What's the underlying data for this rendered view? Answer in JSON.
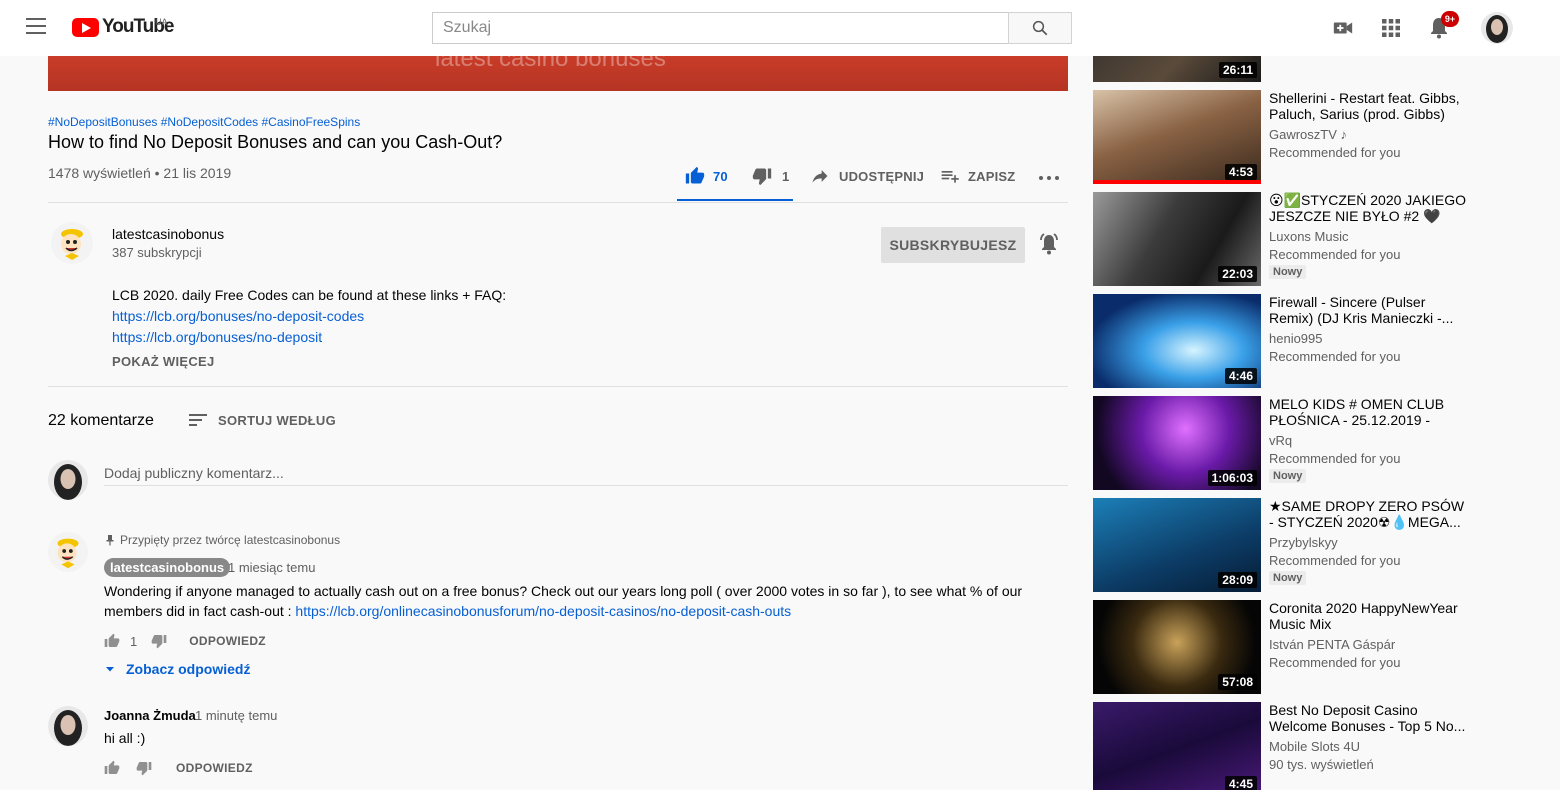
{
  "header": {
    "logo_text": "YouTube",
    "country": "UA",
    "search_placeholder": "Szukaj",
    "notifications_badge": "9+"
  },
  "video": {
    "watermark_text": "latest casino bonuses",
    "hashtags": [
      "#NoDepositBonuses",
      "#NoDepositCodes",
      "#CasinoFreeSpins"
    ],
    "title": "How to find No Deposit Bonuses and can you Cash-Out?",
    "views_date": "1478 wyświetleń • 21 lis 2019",
    "likes": "70",
    "dislikes": "1",
    "share_label": "UDOSTĘPNIJ",
    "save_label": "ZAPISZ"
  },
  "channel": {
    "name": "latestcasinobonus",
    "subscribers": "387 subskrypcji",
    "subscribed_label": "SUBSKRYBUJESZ"
  },
  "description": {
    "line1": "LCB 2020. daily Free Codes can be found at these links + FAQ:",
    "link1": "https://lcb.org/bonuses/no-deposit-codes",
    "link2": "https://lcb.org/bonuses/no-deposit",
    "show_more": "POKAŻ WIĘCEJ"
  },
  "comments": {
    "count": "22 komentarze",
    "sort_label": "SORTUJ WEDŁUG",
    "input_placeholder": "Dodaj publiczny komentarz...",
    "pinned": {
      "pinned_label": "Przypięty przez twórcę latestcasinobonus",
      "author": "latestcasinobonus",
      "time": "1 miesiąc temu",
      "text_line1": "Wondering if anyone managed to actually cash out on a free bonus? Check out our years long poll ( over 2000 votes in so far ),  to see what % of our",
      "text_line2": "members did in fact cash-out : ",
      "link": "https://lcb.org/onlinecasinobonusforum/no-deposit-casinos/no-deposit-cash-outs",
      "likes": "1",
      "reply_label": "ODPOWIEDZ",
      "view_replies": "Zobacz odpowiedź"
    },
    "second": {
      "author": "Joanna Żmuda",
      "time": "1 minutę temu",
      "text": "hi all :)",
      "reply_label": "ODPOWIEDZ"
    }
  },
  "recommendations": [
    {
      "title": "",
      "channel": "",
      "meta": "",
      "duration": "26:11",
      "badge": ""
    },
    {
      "title": "Shellerini - Restart feat. Gibbs, Paluch, Sarius (prod. Gibbs)",
      "channel": "GawroszTV ♪",
      "meta": "Recommended for you",
      "duration": "4:53",
      "badge": "",
      "progress": 1.0
    },
    {
      "title": "😮✅STYCZEŃ 2020 JAKIEGO JESZCZE NIE BYŁO #2 🖤✅...",
      "channel": "Luxons Music",
      "meta": "Recommended for you",
      "duration": "22:03",
      "badge": "Nowy"
    },
    {
      "title": "Firewall - Sincere (Pulser Remix) (DJ Kris Manieczki -...",
      "channel": "henio995",
      "meta": "Recommended for you",
      "duration": "4:46",
      "badge": ""
    },
    {
      "title": "MELO KIDS # OMEN CLUB PŁOŚNICA - 25.12.2019 - BOŻ...",
      "channel": "vRq",
      "meta": "Recommended for you",
      "duration": "1:06:03",
      "badge": "Nowy"
    },
    {
      "title": "★SAME DROPY ZERO PSÓW - STYCZEŃ 2020☢💧MEGA...",
      "channel": "Przybylskyy",
      "meta": "Recommended for you",
      "duration": "28:09",
      "badge": "Nowy"
    },
    {
      "title": "Coronita 2020 HappyNewYear Music Mix",
      "channel": "István PENTA Gáspár",
      "meta": "Recommended for you",
      "duration": "57:08",
      "badge": ""
    },
    {
      "title": "Best No Deposit Casino Welcome Bonuses - Top 5 No...",
      "channel": "Mobile Slots 4U",
      "meta": "90 tys. wyświetleń",
      "duration": "4:45",
      "badge": ""
    }
  ]
}
